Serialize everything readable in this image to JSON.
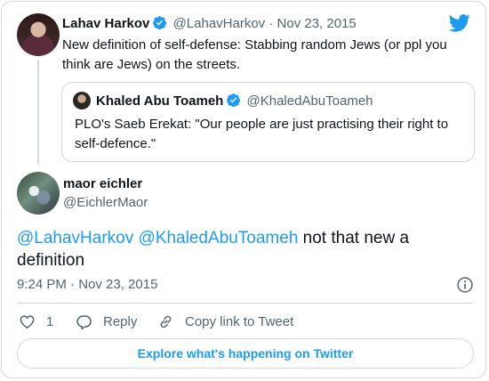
{
  "colors": {
    "link_blue": "#1d9bf0",
    "muted_gray": "#536471",
    "border_gray": "#cfd9de"
  },
  "parent_tweet": {
    "author_name": "Lahav Harkov",
    "handle": "@LahavHarkov",
    "separator": "·",
    "date": "Nov 23, 2015",
    "text": "New definition of self-defense: Stabbing random Jews (or ppl you think are Jews) on the streets."
  },
  "quoted_tweet": {
    "author_name": "Khaled Abu Toameh",
    "handle": "@KhaledAbuToameh",
    "text": "PLO's Saeb Erekat: \"Our people are just practising their right to self-defence.\""
  },
  "main_tweet": {
    "author_name": "maor eichler",
    "handle": "@EichlerMaor",
    "mention_1": "@LahavHarkov",
    "mention_2": "@KhaledAbuToameh",
    "text_rest": " not that new a definition",
    "timestamp": "9:24 PM · Nov 23, 2015"
  },
  "actions": {
    "like_count": "1",
    "reply_label": "Reply",
    "copy_link_label": "Copy link to Tweet"
  },
  "explore_label": "Explore what's happening on Twitter",
  "icons": [
    "twitter-bird-icon",
    "verified-badge-icon",
    "info-icon",
    "heart-icon",
    "reply-bubble-icon",
    "link-icon"
  ]
}
